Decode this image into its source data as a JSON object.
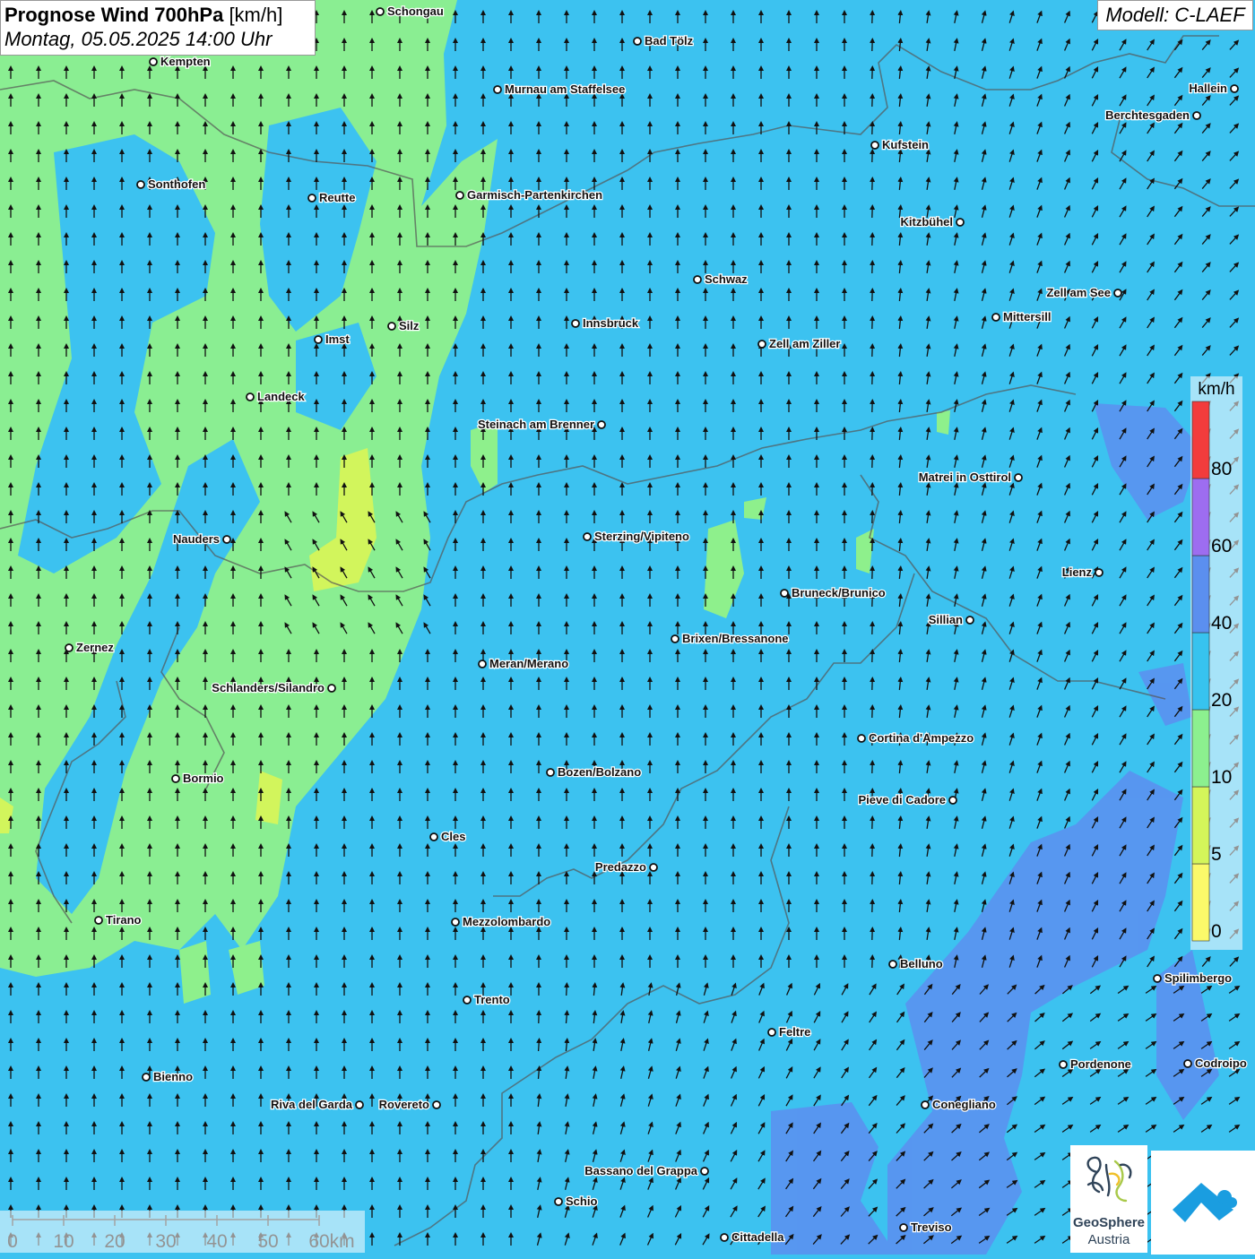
{
  "header": {
    "title_bold": "Prognose Wind 700hPa",
    "title_unit": "[km/h]",
    "subtitle": "Montag, 05.05.2025 14:00 Uhr",
    "model": "Modell: C-LAEF"
  },
  "legend": {
    "unit": "km/h",
    "bands": [
      {
        "label": "0",
        "color": "#fbf96a"
      },
      {
        "label": "5",
        "color": "#d4f55a"
      },
      {
        "label": "10",
        "color": "#8cf08f"
      },
      {
        "label": "20",
        "color": "#37c3ef"
      },
      {
        "label": "40",
        "color": "#5b8fef"
      },
      {
        "label": "60",
        "color": "#9d6df0"
      },
      {
        "label": "80",
        "color": "#f23c3c"
      }
    ]
  },
  "scale_bar": {
    "ticks": [
      "0",
      "10",
      "20",
      "30",
      "40",
      "50",
      "60km"
    ]
  },
  "logos": {
    "geosphere_line1": "GeoSphere",
    "geosphere_line2": "Austria"
  },
  "cities": [
    {
      "name": "Schongau"
    },
    {
      "name": "Bad Tölz"
    },
    {
      "name": "Kempten"
    },
    {
      "name": "Murnau am Staffelsee"
    },
    {
      "name": "Hallein"
    },
    {
      "name": "Berchtesgaden"
    },
    {
      "name": "Kufstein"
    },
    {
      "name": "Sonthofen"
    },
    {
      "name": "Reutte"
    },
    {
      "name": "Garmisch-Partenkirchen"
    },
    {
      "name": "Kitzbühel"
    },
    {
      "name": "Schwaz"
    },
    {
      "name": "Zell am See"
    },
    {
      "name": "Mittersill"
    },
    {
      "name": "Innsbruck"
    },
    {
      "name": "Imst"
    },
    {
      "name": "Silz"
    },
    {
      "name": "Zell am Ziller"
    },
    {
      "name": "Landeck"
    },
    {
      "name": "Steinach am Brenner"
    },
    {
      "name": "Matrei in Osttirol"
    },
    {
      "name": "Nauders"
    },
    {
      "name": "Sterzing/Vipiteno"
    },
    {
      "name": "Lienz"
    },
    {
      "name": "Bruneck/Brunico"
    },
    {
      "name": "Sillian"
    },
    {
      "name": "Zernez"
    },
    {
      "name": "Brixen/Bressanone"
    },
    {
      "name": "Meran/Merano"
    },
    {
      "name": "Schlanders/Silandro"
    },
    {
      "name": "Cortina d'Ampezzo"
    },
    {
      "name": "Bozen/Bolzano"
    },
    {
      "name": "Bormio"
    },
    {
      "name": "Pieve di Cadore"
    },
    {
      "name": "Cles"
    },
    {
      "name": "Predazzo"
    },
    {
      "name": "Tirano"
    },
    {
      "name": "Mezzolombardo"
    },
    {
      "name": "Belluno"
    },
    {
      "name": "Spilimbergo"
    },
    {
      "name": "Trento"
    },
    {
      "name": "Feltre"
    },
    {
      "name": "Pordenone"
    },
    {
      "name": "Codroipo"
    },
    {
      "name": "Bienno"
    },
    {
      "name": "Riva del Garda"
    },
    {
      "name": "Rovereto"
    },
    {
      "name": "Conegliano"
    },
    {
      "name": "Bassano del Grappa"
    },
    {
      "name": "Schio"
    },
    {
      "name": "Treviso"
    },
    {
      "name": "Cittadella"
    }
  ]
}
